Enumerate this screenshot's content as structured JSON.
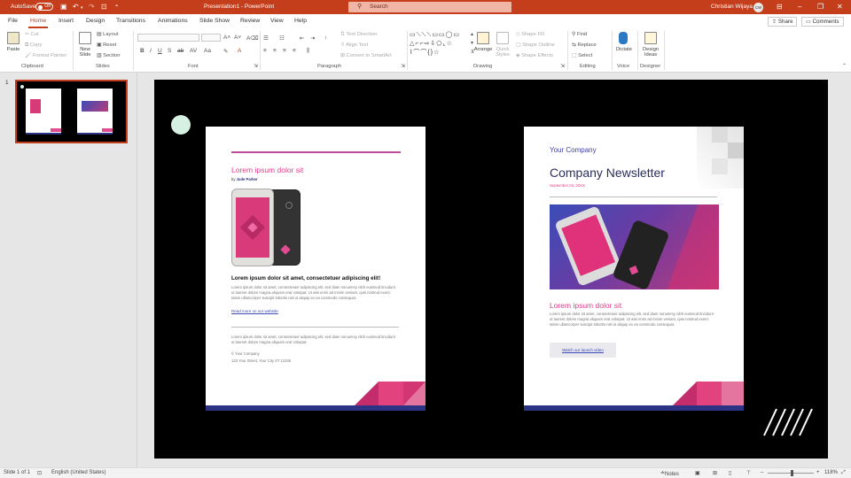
{
  "titlebar": {
    "autosave_label": "AutoSave",
    "autosave_state": "Off",
    "document_title": "Presentation1  -  PowerPoint",
    "search_placeholder": "Search",
    "user_name": "Christian Wijaya",
    "user_initials": "CW",
    "bg_color": "#c43e1c"
  },
  "tabs": [
    "File",
    "Home",
    "Insert",
    "Design",
    "Transitions",
    "Animations",
    "Slide Show",
    "Review",
    "View",
    "Help"
  ],
  "active_tab": "Home",
  "share_label": "Share",
  "comments_label": "Comments",
  "ribbon": {
    "clipboard": {
      "label": "Clipboard",
      "paste": "Paste",
      "cut": "Cut",
      "copy": "Copy",
      "format_painter": "Format Painter"
    },
    "slides": {
      "label": "Slides",
      "new_slide": "New Slide",
      "layout": "Layout",
      "reset": "Reset",
      "section": "Section"
    },
    "font": {
      "label": "Font"
    },
    "paragraph": {
      "label": "Paragraph",
      "text_direction": "Text Direction",
      "align_text": "Align Text",
      "smartart": "Convert to SmartArt"
    },
    "drawing": {
      "label": "Drawing",
      "arrange": "Arrange",
      "quick_styles": "Quick Styles",
      "shape_fill": "Shape Fill",
      "shape_outline": "Shape Outline",
      "shape_effects": "Shape Effects"
    },
    "editing": {
      "label": "Editing",
      "find": "Find",
      "replace": "Replace",
      "select": "Select"
    },
    "voice": {
      "label": "Voice",
      "dictate": "Dictate"
    },
    "designer": {
      "label": "Designer",
      "design_ideas": "Design Ideas"
    }
  },
  "thumbnails": [
    {
      "number": "1"
    }
  ],
  "slide": {
    "left_page": {
      "title": "Lorem ipsum dolor sit",
      "byline_prefix": "by ",
      "byline_author": "Jude Parker",
      "heading": "Lorem ipsum dolor sit amet, consectetuer adipiscing elit!",
      "body": "Lorem ipsum dolor sit amet, consectetuer adipiscing elit, sed diam nonummy nibh euismod tincidunt ut laoreet dolore magna aliquam erat volutpat. Ut wisi enim ad minim veniam, quis nostrud exerci tation ullamcorper suscipit lobortis nisl ut aliquip ex ea commodo consequat.",
      "link": "Read more on our website",
      "body2": "Lorem ipsum dolor sit amet, consectetuer adipiscing elit, sed diam nonummy nibh euismod tincidunt ut laoreet dolore magna aliquam erat volutpat.",
      "company": "© Your Company",
      "address": "123 Your Street, Your City ST 12345"
    },
    "right_page": {
      "company": "Your Company",
      "title": "Company Newsletter",
      "date": "September 04, 20XX",
      "subtitle": "Lorem ipsum dolor sit",
      "body": "Lorem ipsum dolor sit amet, consectetuer adipiscing elit, sed diam nonummy nibh euismod tincidunt ut laoreet dolore magna aliquam erat volutpat. Ut wisi enim ad minim veniam, quis nostrud exerci tation ullamcorper suscipit lobortis nisl ut aliquip ex ea commodo consequat.",
      "button": "Watch our launch video"
    },
    "accent_pink": "#e23b8a",
    "accent_navy": "#2c3385"
  },
  "statusbar": {
    "slide_info": "Slide 1 of 1",
    "language": "English (United States)",
    "notes": "Notes",
    "zoom": "118%"
  }
}
